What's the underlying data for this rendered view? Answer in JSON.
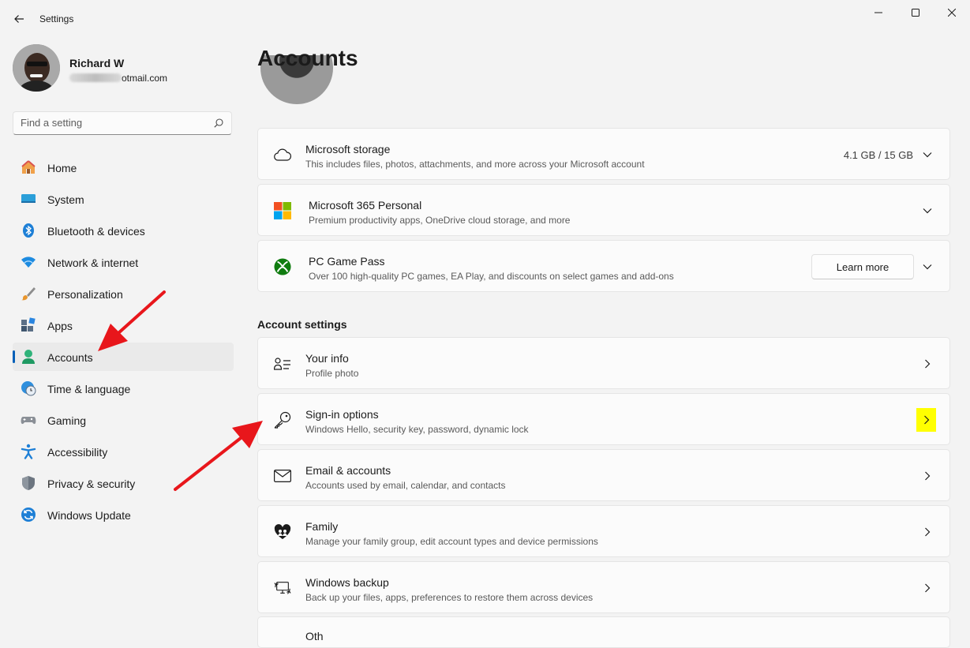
{
  "window": {
    "title": "Settings",
    "back_label": "Back",
    "minimize_label": "Minimize",
    "maximize_label": "Maximize",
    "close_label": "Close"
  },
  "profile": {
    "name": "Richard W",
    "email_visible": "otmail.com"
  },
  "search": {
    "placeholder": "Find a setting"
  },
  "sidebar": {
    "items": [
      {
        "label": "Home",
        "icon": "home-icon"
      },
      {
        "label": "System",
        "icon": "system-icon"
      },
      {
        "label": "Bluetooth & devices",
        "icon": "bluetooth-icon"
      },
      {
        "label": "Network & internet",
        "icon": "wifi-icon"
      },
      {
        "label": "Personalization",
        "icon": "brush-icon"
      },
      {
        "label": "Apps",
        "icon": "apps-icon"
      },
      {
        "label": "Accounts",
        "icon": "accounts-icon",
        "active": true
      },
      {
        "label": "Time & language",
        "icon": "globe-clock-icon"
      },
      {
        "label": "Gaming",
        "icon": "gamepad-icon"
      },
      {
        "label": "Accessibility",
        "icon": "accessibility-icon"
      },
      {
        "label": "Privacy & security",
        "icon": "shield-icon"
      },
      {
        "label": "Windows Update",
        "icon": "update-icon"
      }
    ]
  },
  "main": {
    "title": "Accounts",
    "top_cards": [
      {
        "title": "Microsoft storage",
        "subtitle": "This includes files, photos, attachments, and more across your Microsoft account",
        "value": "4.1 GB / 15 GB",
        "icon": "cloud-icon"
      },
      {
        "title": "Microsoft 365 Personal",
        "subtitle": "Premium productivity apps, OneDrive cloud storage, and more",
        "icon": "microsoft-logo-icon"
      },
      {
        "title": "PC Game Pass",
        "subtitle": "Over 100 high-quality PC games, EA Play, and discounts on select games and add-ons",
        "button": "Learn more",
        "icon": "xbox-icon"
      }
    ],
    "section_heading": "Account settings",
    "settings": [
      {
        "title": "Your info",
        "subtitle": "Profile photo",
        "icon": "person-info-icon"
      },
      {
        "title": "Sign-in options",
        "subtitle": "Windows Hello, security key, password, dynamic lock",
        "icon": "key-icon"
      },
      {
        "title": "Email & accounts",
        "subtitle": "Accounts used by email, calendar, and contacts",
        "icon": "mail-icon"
      },
      {
        "title": "Family",
        "subtitle": "Manage your family group, edit account types and device permissions",
        "icon": "family-heart-icon"
      },
      {
        "title": "Windows backup",
        "subtitle": "Back up your files, apps, preferences to restore them across devices",
        "icon": "backup-icon"
      },
      {
        "title": "Oth",
        "subtitle": "",
        "icon": ""
      }
    ]
  },
  "colors": {
    "accent": "#005fb8",
    "annotation_arrow": "#e8161b",
    "highlight": "#ffff00"
  }
}
